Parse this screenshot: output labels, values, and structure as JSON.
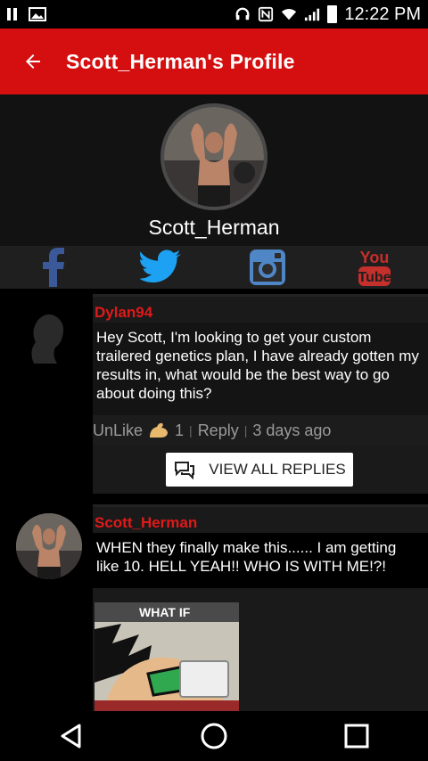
{
  "status_bar": {
    "time": "12:22 PM",
    "icons": [
      "pause-icon",
      "image-icon",
      "headset-icon",
      "nfc-icon",
      "wifi-icon",
      "signal-icon",
      "battery-icon"
    ]
  },
  "header": {
    "back_icon": "arrow-left-icon",
    "title": "Scott_Herman's Profile",
    "bg_color": "#d50f0f"
  },
  "profile": {
    "name": "Scott_Herman"
  },
  "social": [
    {
      "name": "facebook",
      "label": "f",
      "color": "#3b5998"
    },
    {
      "name": "twitter",
      "color": "#1da1f2"
    },
    {
      "name": "instagram",
      "color": "#4f86c6"
    },
    {
      "name": "youtube",
      "label_top": "You",
      "label_bottom": "Tube",
      "color": "#c4302b"
    }
  ],
  "comments": [
    {
      "username": "Dylan94",
      "text": "Hey Scott, I'm looking to get your custom trailered genetics plan, I have already gotten my results in, what would be the best way to go about doing this?",
      "like_label": "UnLike",
      "like_count": "1",
      "reply_label": "Reply",
      "time_ago": "3 days ago",
      "view_all_label": "VIEW ALL REPLIES"
    },
    {
      "username": "Scott_Herman",
      "text": "WHEN they finally make this...... I am getting like 10.  HELL YEAH!!  WHO IS WITH ME!?!",
      "meme_caption": "WHAT IF"
    }
  ],
  "nav_bar": {
    "back": "triangle-back-icon",
    "home": "circle-home-icon",
    "recents": "square-recents-icon"
  },
  "colors": {
    "username": "#e11919",
    "card_bg": "#1a1a1a"
  }
}
